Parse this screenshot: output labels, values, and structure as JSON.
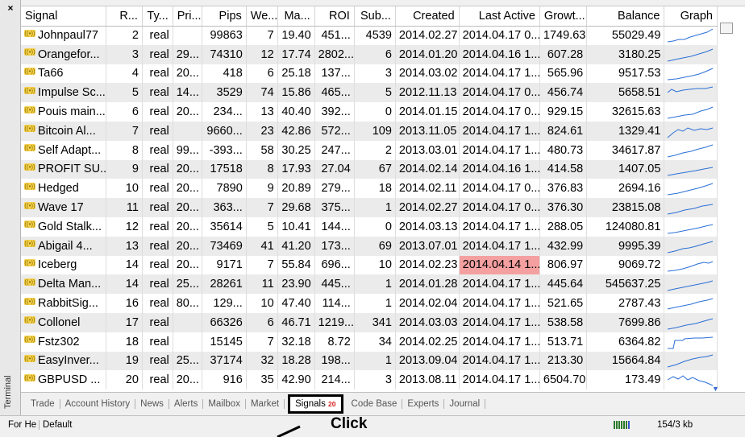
{
  "window": {
    "close_label": "×",
    "side_label": "Terminal"
  },
  "columns": [
    "Signal",
    "R...",
    "Ty...",
    "Pri...",
    "Pips",
    "We...",
    "Ma...",
    "ROI",
    "Sub...",
    "Created",
    "Last Active",
    "Growt...",
    "Balance",
    "Graph"
  ],
  "rows": [
    {
      "signal": "Johnpaul77",
      "rank": "2",
      "type": "real",
      "price": "",
      "pips": "99863",
      "weeks": "7",
      "ma": "19.40",
      "roi": "451...",
      "sub": "4539",
      "created": "2014.02.27",
      "last": "2014.04.17 0...",
      "growth": "1749.63",
      "balance": "55029.49"
    },
    {
      "signal": "Orangefor...",
      "rank": "3",
      "type": "real",
      "price": "29...",
      "pips": "74310",
      "weeks": "12",
      "ma": "17.74",
      "roi": "2802...",
      "sub": "6",
      "created": "2014.01.20",
      "last": "2014.04.16 1...",
      "growth": "607.28",
      "balance": "3180.25"
    },
    {
      "signal": "Ta66",
      "rank": "4",
      "type": "real",
      "price": "20...",
      "pips": "418",
      "weeks": "6",
      "ma": "25.18",
      "roi": "137...",
      "sub": "3",
      "created": "2014.03.02",
      "last": "2014.04.17 1...",
      "growth": "565.96",
      "balance": "9517.53"
    },
    {
      "signal": "Impulse Sc...",
      "rank": "5",
      "type": "real",
      "price": "14...",
      "pips": "3529",
      "weeks": "74",
      "ma": "15.86",
      "roi": "465...",
      "sub": "5",
      "created": "2012.11.13",
      "last": "2014.04.17 0...",
      "growth": "456.74",
      "balance": "5658.51"
    },
    {
      "signal": "Pouis main...",
      "rank": "6",
      "type": "real",
      "price": "20...",
      "pips": "234...",
      "weeks": "13",
      "ma": "40.40",
      "roi": "392...",
      "sub": "0",
      "created": "2014.01.15",
      "last": "2014.04.17 0...",
      "growth": "929.15",
      "balance": "32615.63"
    },
    {
      "signal": "Bitcoin Al...",
      "rank": "7",
      "type": "real",
      "price": "",
      "pips": "9660...",
      "weeks": "23",
      "ma": "42.86",
      "roi": "572...",
      "sub": "109",
      "created": "2013.11.05",
      "last": "2014.04.17 1...",
      "growth": "824.61",
      "balance": "1329.41"
    },
    {
      "signal": "Self Adapt...",
      "rank": "8",
      "type": "real",
      "price": "99...",
      "pips": "-393...",
      "weeks": "58",
      "ma": "30.25",
      "roi": "247...",
      "sub": "2",
      "created": "2013.03.01",
      "last": "2014.04.17 1...",
      "growth": "480.73",
      "balance": "34617.87"
    },
    {
      "signal": "PROFIT SU...",
      "rank": "9",
      "type": "real",
      "price": "20...",
      "pips": "17518",
      "weeks": "8",
      "ma": "17.93",
      "roi": "27.04",
      "sub": "67",
      "created": "2014.02.14",
      "last": "2014.04.16 1...",
      "growth": "414.58",
      "balance": "1407.05"
    },
    {
      "signal": "Hedged",
      "rank": "10",
      "type": "real",
      "price": "20...",
      "pips": "7890",
      "weeks": "9",
      "ma": "20.89",
      "roi": "279...",
      "sub": "18",
      "created": "2014.02.11",
      "last": "2014.04.17 0...",
      "growth": "376.83",
      "balance": "2694.16"
    },
    {
      "signal": "Wave 17",
      "rank": "11",
      "type": "real",
      "price": "20...",
      "pips": "363...",
      "weeks": "7",
      "ma": "29.68",
      "roi": "375...",
      "sub": "1",
      "created": "2014.02.27",
      "last": "2014.04.17 0...",
      "growth": "376.30",
      "balance": "23815.08"
    },
    {
      "signal": "Gold Stalk...",
      "rank": "12",
      "type": "real",
      "price": "20...",
      "pips": "35614",
      "weeks": "5",
      "ma": "10.41",
      "roi": "144...",
      "sub": "0",
      "created": "2014.03.13",
      "last": "2014.04.17 1...",
      "growth": "288.05",
      "balance": "124080.81"
    },
    {
      "signal": "Abigail 4...",
      "rank": "13",
      "type": "real",
      "price": "20...",
      "pips": "73469",
      "weeks": "41",
      "ma": "41.20",
      "roi": "173...",
      "sub": "69",
      "created": "2013.07.01",
      "last": "2014.04.17 1...",
      "growth": "432.99",
      "balance": "9995.39"
    },
    {
      "signal": "Iceberg",
      "rank": "14",
      "type": "real",
      "price": "20...",
      "pips": "9171",
      "weeks": "7",
      "ma": "55.84",
      "roi": "696...",
      "sub": "10",
      "created": "2014.02.23",
      "last": "2014.04.14 1...",
      "growth": "806.97",
      "balance": "9069.72",
      "highlight": true
    },
    {
      "signal": "Delta Man...",
      "rank": "14",
      "type": "real",
      "price": "25...",
      "pips": "28261",
      "weeks": "11",
      "ma": "23.90",
      "roi": "445...",
      "sub": "1",
      "created": "2014.01.28",
      "last": "2014.04.17 1...",
      "growth": "445.64",
      "balance": "545637.25"
    },
    {
      "signal": "RabbitSig...",
      "rank": "16",
      "type": "real",
      "price": "80...",
      "pips": "129...",
      "weeks": "10",
      "ma": "47.40",
      "roi": "114...",
      "sub": "1",
      "created": "2014.02.04",
      "last": "2014.04.17 1...",
      "growth": "521.65",
      "balance": "2787.43"
    },
    {
      "signal": "Collonel",
      "rank": "17",
      "type": "real",
      "price": "",
      "pips": "66326",
      "weeks": "6",
      "ma": "46.71",
      "roi": "1219...",
      "sub": "341",
      "created": "2014.03.03",
      "last": "2014.04.17 1...",
      "growth": "538.58",
      "balance": "7699.86"
    },
    {
      "signal": "Fstz302",
      "rank": "18",
      "type": "real",
      "price": "",
      "pips": "15145",
      "weeks": "7",
      "ma": "32.18",
      "roi": "8.72",
      "sub": "34",
      "created": "2014.02.25",
      "last": "2014.04.17 1...",
      "growth": "513.71",
      "balance": "6364.82"
    },
    {
      "signal": "EasyInver...",
      "rank": "19",
      "type": "real",
      "price": "25...",
      "pips": "37174",
      "weeks": "32",
      "ma": "18.28",
      "roi": "198...",
      "sub": "1",
      "created": "2013.09.04",
      "last": "2014.04.17 1...",
      "growth": "213.30",
      "balance": "15664.84"
    },
    {
      "signal": "GBPUSD ...",
      "rank": "20",
      "type": "real",
      "price": "20...",
      "pips": "916",
      "weeks": "35",
      "ma": "42.90",
      "roi": "214...",
      "sub": "3",
      "created": "2013.08.11",
      "last": "2014.04.17 1...",
      "growth": "6504.70",
      "balance": "173.49"
    }
  ],
  "tabs": [
    {
      "label": "Trade"
    },
    {
      "label": "Account History"
    },
    {
      "label": "News"
    },
    {
      "label": "Alerts"
    },
    {
      "label": "Mailbox"
    },
    {
      "label": "Market"
    },
    {
      "label": "Signals",
      "badge": "20",
      "active": true
    },
    {
      "label": "Code Base"
    },
    {
      "label": "Experts"
    },
    {
      "label": "Journal"
    }
  ],
  "status": {
    "help": "For He",
    "profile": "Default",
    "traffic": "154/3 kb"
  },
  "annotation": "Click",
  "colors": {
    "highlight": "#f4a0a0",
    "spark": "#2a6fd6",
    "badge": "#d81b1b"
  }
}
